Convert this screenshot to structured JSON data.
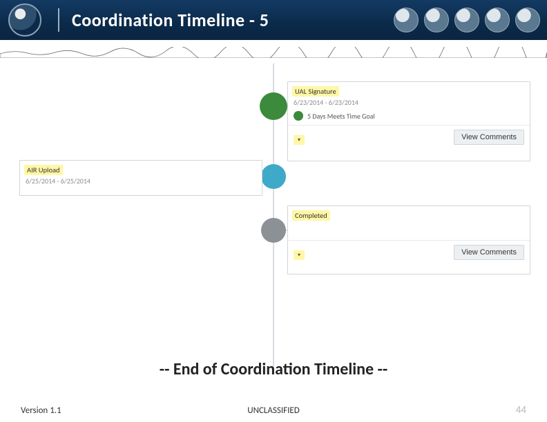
{
  "header": {
    "title": "Coordination Timeline - 5",
    "seals": [
      "dod-seal",
      "army-seal",
      "marine-seal",
      "navy-seal",
      "airforce-seal",
      "coastguard-seal"
    ]
  },
  "timeline": {
    "items": [
      {
        "side": "right",
        "node_color": "green",
        "title": "UAL Signature",
        "dates": "6/23/2014 - 6/23/2014",
        "status": "5 Days Meets Time Goal",
        "dropdown": "▾",
        "action": "View Comments"
      },
      {
        "side": "left",
        "node_color": "blue",
        "title": "AIR Upload",
        "dates": "6/25/2014 - 6/25/2014"
      },
      {
        "side": "right",
        "node_color": "gray",
        "title": "Completed",
        "dropdown": "▾",
        "action": "View Comments"
      }
    ]
  },
  "end_text": "-- End of Coordination Timeline --",
  "footer": {
    "version": "Version 1.1",
    "classification": "UNCLASSIFIED",
    "page": "44"
  }
}
